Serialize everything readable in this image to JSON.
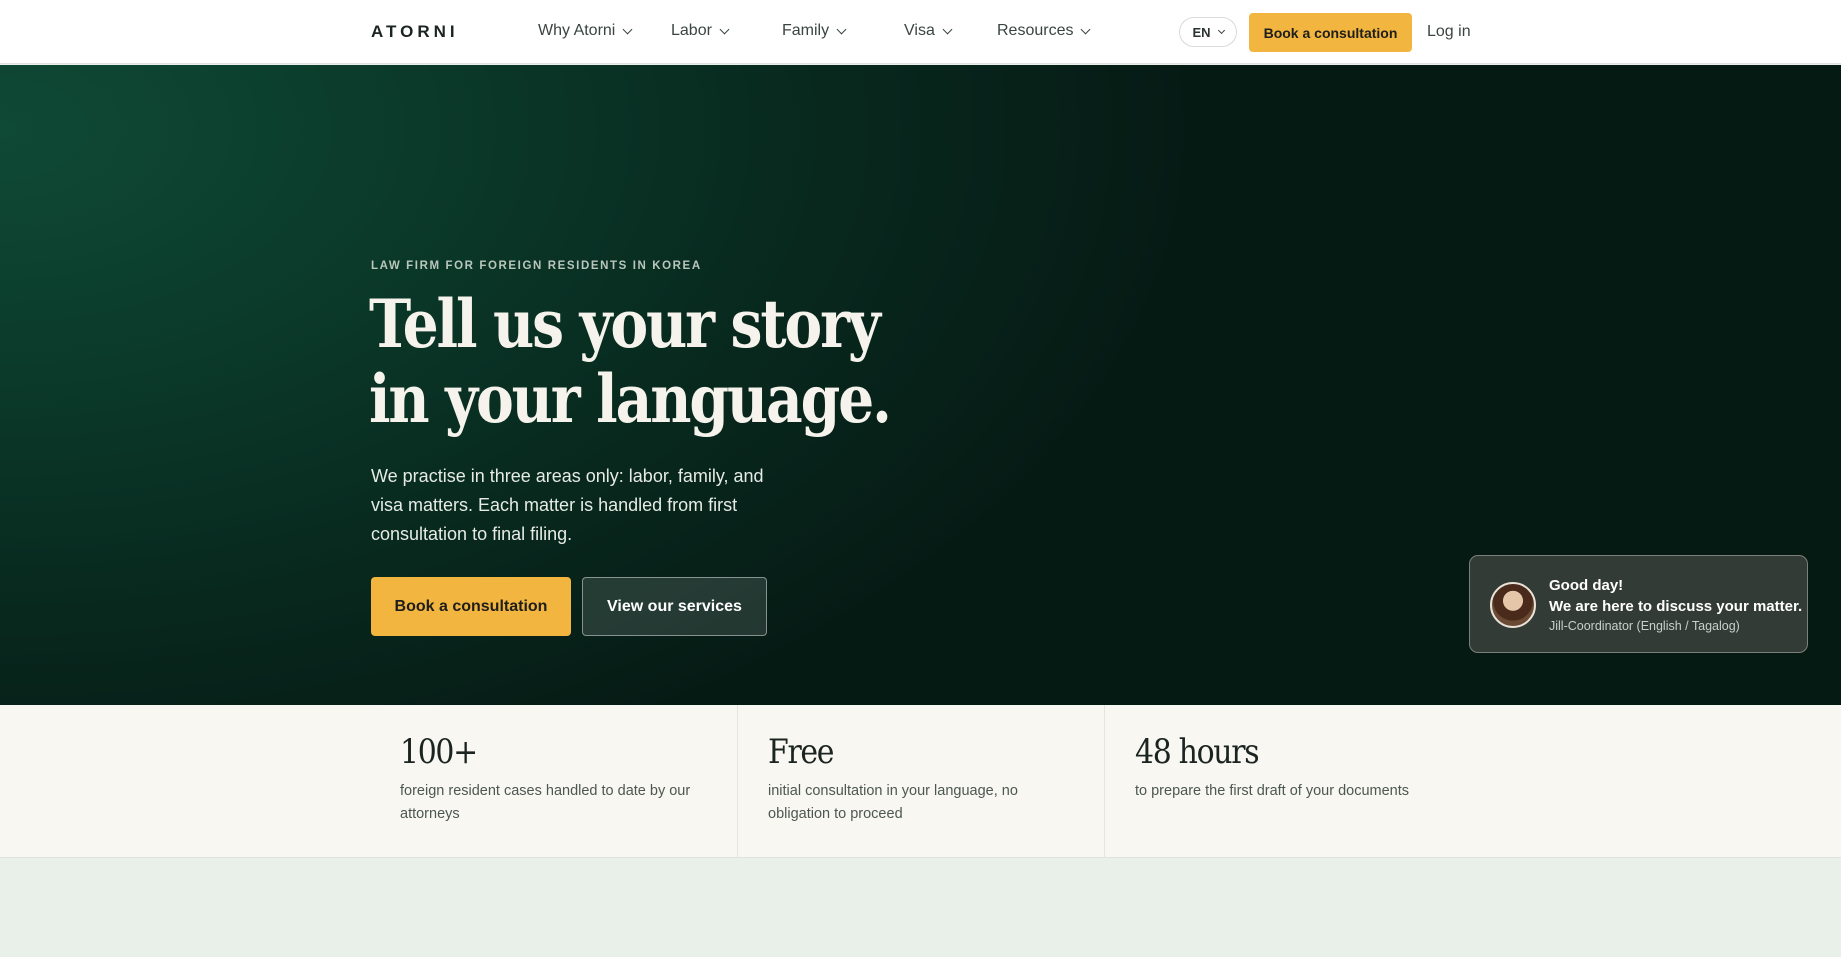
{
  "header": {
    "logo": "ATORNI",
    "nav": [
      {
        "label": "Why Atorni"
      },
      {
        "label": "Labor"
      },
      {
        "label": "Family"
      },
      {
        "label": "Visa"
      },
      {
        "label": "Resources"
      }
    ],
    "language": "EN",
    "cta_label": "Book a consultation",
    "login_label": "Log in"
  },
  "hero": {
    "eyebrow": "LAW FIRM FOR FOREIGN RESIDENTS IN KOREA",
    "headline_line1": "Tell us your story",
    "headline_line2": "in your language.",
    "lede": "We practise in three areas only: labor, family, and visa matters. Each matter is handled from first consultation to final filing.",
    "primary_button": "Book a consultation",
    "secondary_button": "View our services"
  },
  "chat": {
    "greeting": "Good day!",
    "message": "We are here to discuss your matter.",
    "agent": "Jill-Coordinator (English / Tagalog)",
    "avatar_icon": "avatar-photo"
  },
  "stats": [
    {
      "value": "100+",
      "desc": "foreign resident cases handled to date by our attorneys"
    },
    {
      "value": "Free",
      "desc": "initial consultation in your language, no obligation to proceed"
    },
    {
      "value": "48 hours",
      "desc": "to prepare the first draft of your documents"
    }
  ],
  "colors": {
    "accent": "#f2b53f",
    "hero_dark": "#082a1f",
    "stats_bg": "#f8f7f2",
    "lower_bg": "#e9efe9"
  }
}
